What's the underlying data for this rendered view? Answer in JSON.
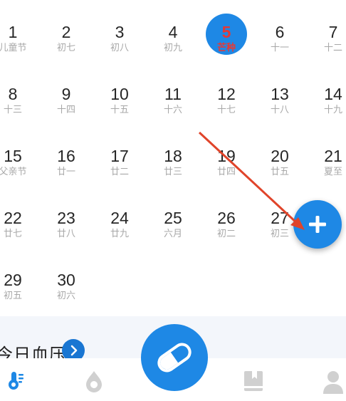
{
  "calendar": {
    "rows": [
      [
        {
          "day": "1",
          "lunar": "儿童节"
        },
        {
          "day": "2",
          "lunar": "初七"
        },
        {
          "day": "3",
          "lunar": "初八"
        },
        {
          "day": "4",
          "lunar": "初九"
        },
        {
          "day": "5",
          "lunar": "芒种",
          "today": true
        },
        {
          "day": "6",
          "lunar": "十一"
        },
        {
          "day": "7",
          "lunar": "十二"
        }
      ],
      [
        {
          "day": "8",
          "lunar": "十三"
        },
        {
          "day": "9",
          "lunar": "十四"
        },
        {
          "day": "10",
          "lunar": "十五"
        },
        {
          "day": "11",
          "lunar": "十六"
        },
        {
          "day": "12",
          "lunar": "十七"
        },
        {
          "day": "13",
          "lunar": "十八"
        },
        {
          "day": "14",
          "lunar": "十九"
        }
      ],
      [
        {
          "day": "15",
          "lunar": "父亲节"
        },
        {
          "day": "16",
          "lunar": "廿一"
        },
        {
          "day": "17",
          "lunar": "廿二"
        },
        {
          "day": "18",
          "lunar": "廿三"
        },
        {
          "day": "19",
          "lunar": "廿四"
        },
        {
          "day": "20",
          "lunar": "廿五"
        },
        {
          "day": "21",
          "lunar": "夏至"
        }
      ],
      [
        {
          "day": "22",
          "lunar": "廿七"
        },
        {
          "day": "23",
          "lunar": "廿八"
        },
        {
          "day": "24",
          "lunar": "廿九"
        },
        {
          "day": "25",
          "lunar": "六月"
        },
        {
          "day": "26",
          "lunar": "初二"
        },
        {
          "day": "27",
          "lunar": "初三"
        },
        {
          "day": "",
          "lunar": ""
        }
      ],
      [
        {
          "day": "29",
          "lunar": "初五"
        },
        {
          "day": "30",
          "lunar": "初六"
        }
      ]
    ]
  },
  "blood_pressure": {
    "title": "今日血压"
  },
  "colors": {
    "accent": "#1e88e5",
    "today_text": "#e53935",
    "muted_icon": "#c8c8c8"
  },
  "icons": {
    "add_fab": "plus-icon",
    "center_fab": "pill-icon",
    "tabs": [
      "thermometer-icon",
      "medicine-drop-icon",
      "book-icon",
      "person-icon"
    ]
  }
}
